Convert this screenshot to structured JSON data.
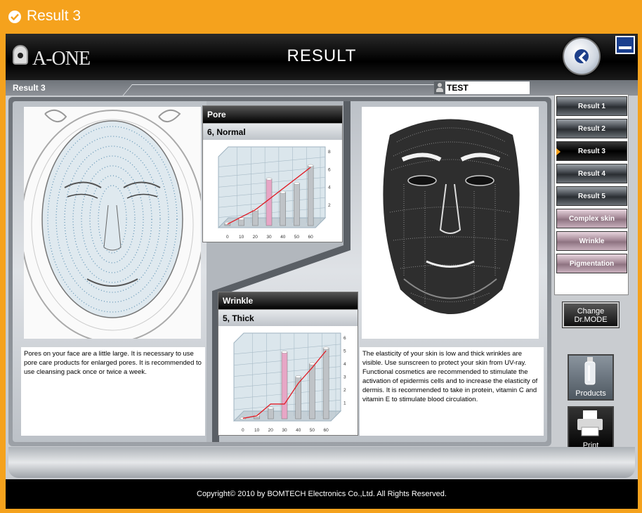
{
  "window": {
    "title": "Result 3"
  },
  "header": {
    "brand": "A-ONE",
    "title": "RESULT"
  },
  "subbar": {
    "label": "Result 3",
    "user": "TEST"
  },
  "pore": {
    "title": "Pore",
    "value": "6,  Normal",
    "description": "Pores on your face are a little large. It is necessary to use pore care products for enlarged pores. It is recommended to use cleansing pack once or twice a week."
  },
  "wrinkle": {
    "title": "Wrinkle",
    "value": "5,  Thick",
    "description": "The elasticity of your skin is low and thick wrinkles are visible. Use sunscreen to protect your skin from UV-ray. Functional cosmetics are recommended to stimulate the activation of epidermis cells and to increase the elasticity of dermis. It is recommended to take in protein, vitamin C and vitamin E to stimulate blood circulation."
  },
  "sidebar": {
    "items": [
      {
        "label": "Result 1"
      },
      {
        "label": "Result 2"
      },
      {
        "label": "Result 3"
      },
      {
        "label": "Result 4"
      },
      {
        "label": "Result 5"
      },
      {
        "label": "Complex skin"
      },
      {
        "label": "Wrinkle"
      },
      {
        "label": "Pigmentation"
      }
    ]
  },
  "buttons": {
    "drmode_line1": "Change",
    "drmode_line2": "Dr.MODE",
    "products": "Products",
    "print": "Print"
  },
  "footer": {
    "copyright": "Copyright© 2010 by BOMTECH Electronics Co.,Ltd. All Rights Reserved."
  },
  "chart_data": [
    {
      "type": "bar",
      "name": "pore-chart",
      "categories": [
        "0",
        "10",
        "20",
        "30",
        "40",
        "50",
        "60"
      ],
      "values": [
        0.5,
        1.0,
        2.0,
        5.5,
        4.0,
        5.0,
        7.0
      ],
      "highlight_index": 3,
      "trend": [
        0.4,
        1.2,
        2.0,
        3.2,
        4.4,
        5.6,
        6.8
      ],
      "ylim": [
        0,
        8
      ],
      "yticks": [
        "2",
        "4",
        "6",
        "8"
      ],
      "colors": {
        "bar": "#bfc3c7",
        "highlight": "#e7a6c6",
        "trend": "#e01b24"
      }
    },
    {
      "type": "bar",
      "name": "wrinkle-chart",
      "categories": [
        "0",
        "10",
        "20",
        "30",
        "40",
        "50",
        "60"
      ],
      "values": [
        0.2,
        0.4,
        1.0,
        5.3,
        3.4,
        4.4,
        5.6
      ],
      "highlight_index": 3,
      "trend": [
        0.2,
        0.4,
        1.3,
        1.3,
        2.9,
        4.1,
        5.4
      ],
      "ylim": [
        0,
        6
      ],
      "yticks": [
        "1",
        "2",
        "3",
        "4",
        "5",
        "6"
      ],
      "colors": {
        "bar": "#bfc3c7",
        "highlight": "#e7a6c6",
        "trend": "#e01b24"
      }
    }
  ]
}
